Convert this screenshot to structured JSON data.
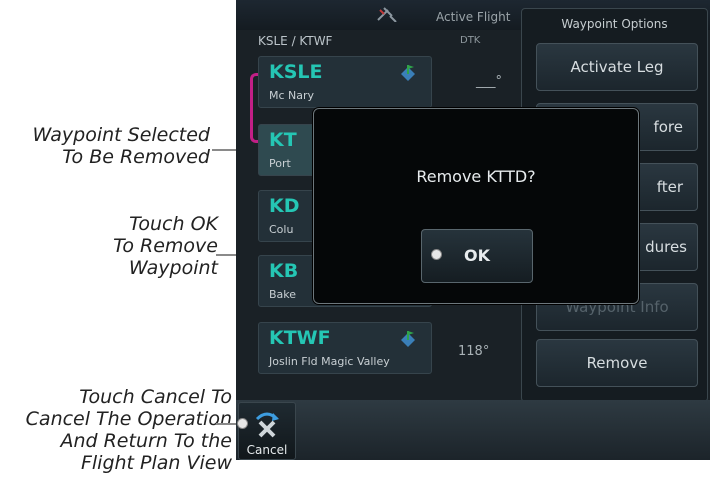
{
  "callouts": {
    "selected": "Waypoint Selected\nTo Be Removed",
    "ok": "Touch OK\nTo Remove\nWaypoint",
    "cancel": "Touch Cancel To\nCancel The Operation\nAnd Return To the\nFlight Plan View"
  },
  "topbar": {
    "title": "Active Flight"
  },
  "flight_plan": {
    "route": "KSLE / KTWF",
    "dtk_label": "DTK",
    "waypoints": [
      {
        "id": "KSLE",
        "name": "Mc Nary",
        "dtk": "___°"
      },
      {
        "id": "KT",
        "name": "Port"
      },
      {
        "id": "KD",
        "name": "Colu"
      },
      {
        "id": "KB",
        "name": "Bake"
      },
      {
        "id": "KTWF",
        "name": "Joslin Fld Magic Valley",
        "dtk": "118°"
      }
    ]
  },
  "options": {
    "title": "Waypoint Options",
    "buttons": [
      "Activate Leg",
      "fore",
      "fter",
      "dures",
      "Waypoint Info",
      "Remove"
    ]
  },
  "dialog": {
    "message": "Remove KTTD?",
    "ok_label": "OK"
  },
  "bottom": {
    "cancel_label": "Cancel"
  },
  "colors": {
    "waypoint_id": "#25c6b4",
    "bracket": "#c21f86",
    "screen_bg": "#1a2126"
  }
}
